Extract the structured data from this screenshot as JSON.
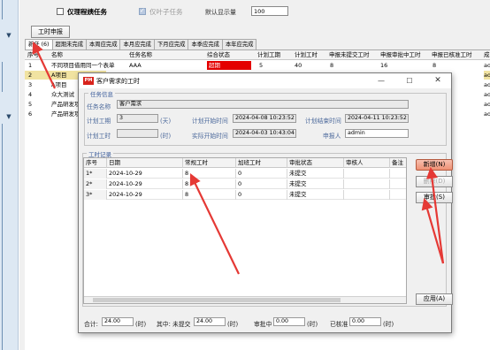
{
  "toolbar": {
    "only_mine_label": "仅理程姨任务",
    "only_leaf_label": "仅叶子任务",
    "default_rows_label": "默认显示量",
    "default_rows_value": "100",
    "report_button": "工时申报"
  },
  "tabs": [
    {
      "label": "新任 (6)"
    },
    {
      "label": "超期未完成"
    },
    {
      "label": "本周应完成"
    },
    {
      "label": "本月应完成"
    },
    {
      "label": "下月应完成"
    },
    {
      "label": "本季应完成"
    },
    {
      "label": "本年应完成"
    }
  ],
  "task_grid": {
    "headers": [
      "序号",
      "名称",
      "任务名称",
      "综合状态",
      "计划工期",
      "计划工时",
      "申报未提交工时",
      "申报审批中工时",
      "申报已核准工时",
      "成"
    ],
    "rows": [
      {
        "no": "1",
        "name": "不同项目借用同一个表单",
        "task": "AAA",
        "status": "超期",
        "plan_days": "5",
        "plan_hours": "40",
        "unsub": "8",
        "approving": "16",
        "approved": "8",
        "extra": "ad"
      },
      {
        "no": "2",
        "name": "A项目",
        "extra": "ad"
      },
      {
        "no": "3",
        "name": "A项目",
        "extra": "ad"
      },
      {
        "no": "4",
        "name": "众大测试",
        "extra": "ad"
      },
      {
        "no": "5",
        "name": "产品研发项",
        "extra": "ad"
      },
      {
        "no": "6",
        "name": "产品研发项",
        "extra": "ad"
      }
    ]
  },
  "dialog": {
    "logo": "PM",
    "title": "客户需求的工时",
    "task_info_legend": "任务信息",
    "task_name_label": "任务名称",
    "task_name_value": "客户需求",
    "plan_days_label": "计划工期",
    "plan_days_value": "3",
    "days_unit": "(天)",
    "plan_start_label": "计划开始时间",
    "plan_start_value": "2024-04-08 10:23:52",
    "plan_end_label": "计划结束时间",
    "plan_end_value": "2024-04-11 10:23:52",
    "plan_hours_label": "计划工时",
    "plan_hours_value": "",
    "hours_unit": "(时)",
    "actual_start_label": "实际开始时间",
    "actual_start_value": "2024-04-03 10:43:04",
    "applicant_label": "申报人",
    "applicant_value": "admin",
    "record_legend": "工时记录",
    "record_headers": [
      "序号",
      "日期",
      "常规工时",
      "加班工时",
      "审批状态",
      "审核人",
      "备注"
    ],
    "records": [
      {
        "no": "1*",
        "date": "2024-10-29",
        "regular": "8",
        "overtime": "0",
        "state": "未提交",
        "reviewer": "",
        "note": ""
      },
      {
        "no": "2*",
        "date": "2024-10-29",
        "regular": "8",
        "overtime": "0",
        "state": "未提交",
        "reviewer": "",
        "note": ""
      },
      {
        "no": "3*",
        "date": "2024-10-29",
        "regular": "8",
        "overtime": "0",
        "state": "未提交",
        "reviewer": "",
        "note": ""
      }
    ],
    "buttons": {
      "add": "新增(N)",
      "delete": "删除(D)",
      "approve": "审批(S)",
      "apply": "应用(A)"
    },
    "footer": {
      "total_label": "合计:",
      "total_value": "24.00",
      "hour_unit": "(时)",
      "of_which_label": "其中: 未提交",
      "unsubmitted_value": "24.00",
      "approving_label": "审批中",
      "approving_value": "0.00",
      "approved_label": "已核准",
      "approved_value": "0.00"
    }
  },
  "colors": {
    "overdue_status": "#e40000",
    "selected_row": "#f1e3a1",
    "annotation_arrow": "#e53935",
    "primary_button": "#ef9174"
  }
}
